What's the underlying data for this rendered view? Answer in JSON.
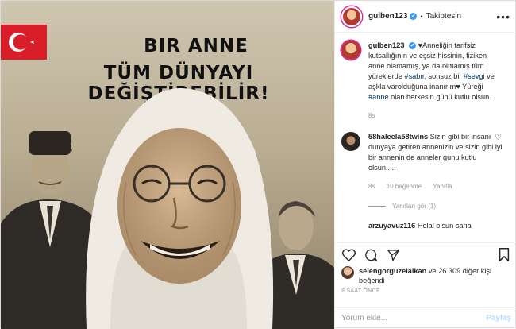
{
  "header": {
    "username": "gulben123",
    "verified_mark": "✔",
    "separator": "•",
    "follow_status": "Takiptesin",
    "more_icon": "ellipsis-icon"
  },
  "poster": {
    "line1": "BIR ANNE",
    "line2": "TÜM DÜNYAYI DEĞİŞTİREBİLİR!"
  },
  "caption": {
    "username": "gulben123",
    "parts": [
      "♥Anneliğin tarifsiz kutsallığının ve eşsiz hissinin, fiziken anne olamamış, ya da olmamış tüm yüreklerde ",
      "#sabır",
      ", sonsuz bir ",
      "#sevgi",
      " ve aşkla varolduğuna inanırım♥ Yüreği ",
      "#anne",
      " olan herkesin günü kutlu olsun..."
    ],
    "age": "8s"
  },
  "comment": {
    "username": "58haleela58twins",
    "text": "Sizin gibi bir insanı dunyaya getiren annenizin ve sizin gibi iyi bir annenin de anneler gunu kutlu olsun.....",
    "age": "8s",
    "likes": "10 beğenme",
    "reply": "Yanıtla",
    "view_replies": "Yanıtları gör (1)"
  },
  "next_comment": {
    "username": "arzuyavuz116",
    "text": "Helal olsun sana"
  },
  "likes": {
    "user": "selengorguzelalkan",
    "rest": " ve 26.309 diğer kişi beğendi"
  },
  "timestamp": "8 SAAT ÖNCE",
  "add_comment": {
    "placeholder": "Yorum ekle...",
    "post_label": "Paylaş"
  },
  "colors": {
    "accent": "#3897f0",
    "hashtag": "#003569",
    "muted": "#999999",
    "post_disabled": "#b3dbff"
  }
}
